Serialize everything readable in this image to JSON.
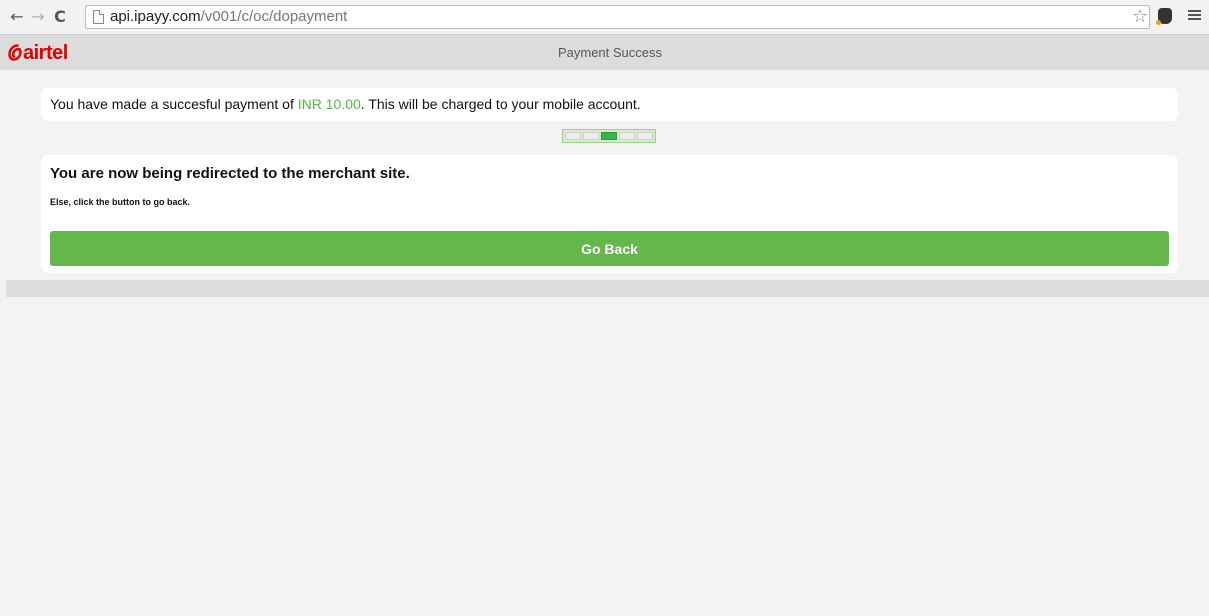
{
  "browser": {
    "back_glyph": "←",
    "forward_glyph": "→",
    "reload_glyph": "C",
    "url_host": "api.ipayy.com",
    "url_path": "/v001/c/oc/dopayment",
    "star_glyph": "☆"
  },
  "header": {
    "logo_text": "airtel",
    "title": "Payment Success",
    "brand_color": "#e40000"
  },
  "payment": {
    "text_before": "You have made a succesful payment of ",
    "amount": "INR 10.00",
    "text_after": ". This will be charged to your mobile account.",
    "amount_color": "#5cb547"
  },
  "progress": {
    "segments": 5,
    "active_index": 2
  },
  "redirect": {
    "heading": "You are now being redirected to the merchant site.",
    "subtext": "Else, click the button to go back.",
    "button_label": "Go Back",
    "button_color": "#63b74b"
  }
}
